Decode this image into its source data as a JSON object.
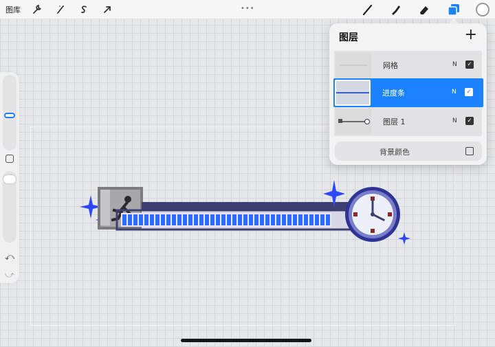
{
  "topbar": {
    "gallery_label": "图库",
    "left_tools": [
      {
        "icon": "wrench-icon",
        "glyph": "🔧"
      },
      {
        "icon": "magic-wand-icon",
        "glyph": "⁄"
      },
      {
        "icon": "selection-icon",
        "glyph": "S"
      },
      {
        "icon": "transform-arrow-icon",
        "glyph": "➚"
      }
    ],
    "more_dots": "•••",
    "right_tools": [
      {
        "icon": "brush-icon"
      },
      {
        "icon": "smudge-icon"
      },
      {
        "icon": "eraser-icon"
      },
      {
        "icon": "layers-icon",
        "active_color": "#1b83ff"
      },
      {
        "icon": "color-icon"
      }
    ]
  },
  "sidebar": {
    "undo_icon": "⤺",
    "redo_icon": "⤻"
  },
  "layers_panel": {
    "title": "图层",
    "add_symbol": "+",
    "layers": [
      {
        "name": "网格",
        "blend": "N",
        "visible": true,
        "selected": false
      },
      {
        "name": "进度条",
        "blend": "N",
        "visible": true,
        "selected": true
      },
      {
        "name": "图层 1",
        "blend": "N",
        "visible": true,
        "selected": false
      }
    ],
    "check_mark": "✓",
    "background_label": "背景颜色"
  },
  "colors": {
    "accent": "#1b83ff",
    "progress_blue": "#2f6bff",
    "bar_navy": "#3d3f73"
  }
}
